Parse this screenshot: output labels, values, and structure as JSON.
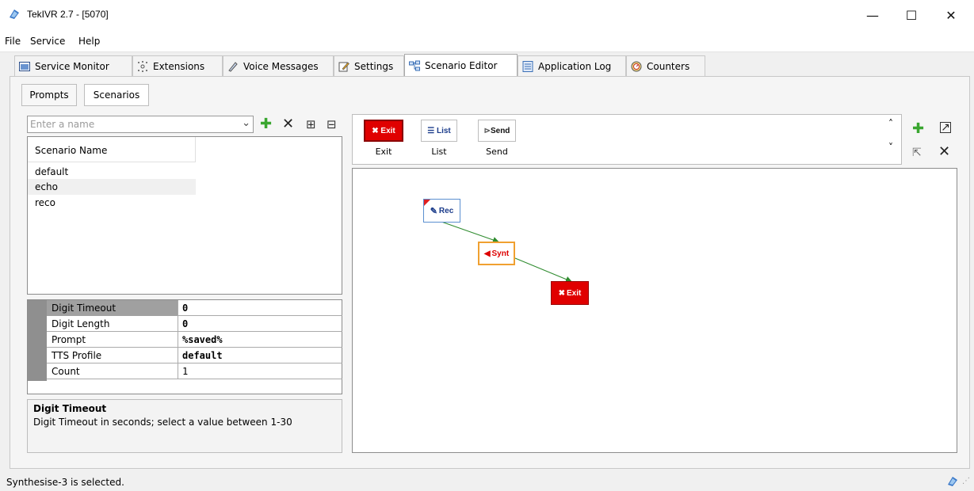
{
  "window": {
    "title": "TekIVR 2.7 - [5070]",
    "minimize_glyph": "—",
    "maximize_glyph": "☐",
    "close_glyph": "✕"
  },
  "menu": [
    {
      "label": "File"
    },
    {
      "label": "Service"
    },
    {
      "label": "Help"
    }
  ],
  "tabs": [
    {
      "label": "Service Monitor",
      "icon": "monitor-icon"
    },
    {
      "label": "Extensions",
      "icon": "extensions-icon"
    },
    {
      "label": "Voice Messages",
      "icon": "voice-messages-icon"
    },
    {
      "label": "Settings",
      "icon": "settings-icon"
    },
    {
      "label": "Scenario Editor",
      "icon": "scenario-editor-icon",
      "active": true
    },
    {
      "label": "Application Log",
      "icon": "log-icon"
    },
    {
      "label": "Counters",
      "icon": "counters-icon"
    }
  ],
  "sub_tabs": [
    {
      "label": "Prompts"
    },
    {
      "label": "Scenarios",
      "active": true
    }
  ],
  "scenario_search": {
    "placeholder": "Enter a name",
    "add_glyph": "✚",
    "delete_glyph": "✕",
    "import_glyph": "⊞",
    "export_glyph": "⊟"
  },
  "scenario_list": {
    "header": "Scenario Name",
    "rows": [
      "default",
      "echo",
      "reco"
    ],
    "selected": "echo"
  },
  "properties": [
    {
      "name": "Digit Timeout",
      "value": "0",
      "bold": true,
      "selected": true
    },
    {
      "name": "Digit Length",
      "value": "0",
      "bold": true
    },
    {
      "name": "Prompt",
      "value": "%saved%",
      "bold": true
    },
    {
      "name": "TTS Profile",
      "value": "default",
      "bold": true
    },
    {
      "name": "Count",
      "value": "1",
      "bold": false
    }
  ],
  "description": {
    "title": "Digit Timeout",
    "text": "Digit Timeout in seconds; select a value between 1-30"
  },
  "toolbox": [
    {
      "block_label": "Exit",
      "caption": "Exit",
      "icon": "exit-icon"
    },
    {
      "block_label": "List",
      "caption": "List",
      "icon": "list-icon"
    },
    {
      "block_label": "Send",
      "caption": "Send",
      "icon": "send-icon"
    }
  ],
  "toolbox_controls": {
    "scroll_up": "˄",
    "scroll_down": "˅",
    "add_glyph": "✚",
    "popout_glyph": "↗",
    "pointer_glyph": "⇱",
    "delete_glyph": "✕"
  },
  "canvas_nodes": [
    {
      "label": "Rec",
      "type": "rec",
      "icon": "record-icon"
    },
    {
      "label": "Synt",
      "type": "synt",
      "icon": "speaker-icon"
    },
    {
      "label": "Exit",
      "type": "exit",
      "icon": "exit-icon"
    }
  ],
  "colors": {
    "exit_red": "#e00000",
    "connector_green": "#2e8b2e",
    "synt_border": "#f0a030",
    "rec_border": "#5b8fd0",
    "add_green": "#3aa630"
  },
  "status": {
    "text": "Synthesise-3 is selected."
  }
}
